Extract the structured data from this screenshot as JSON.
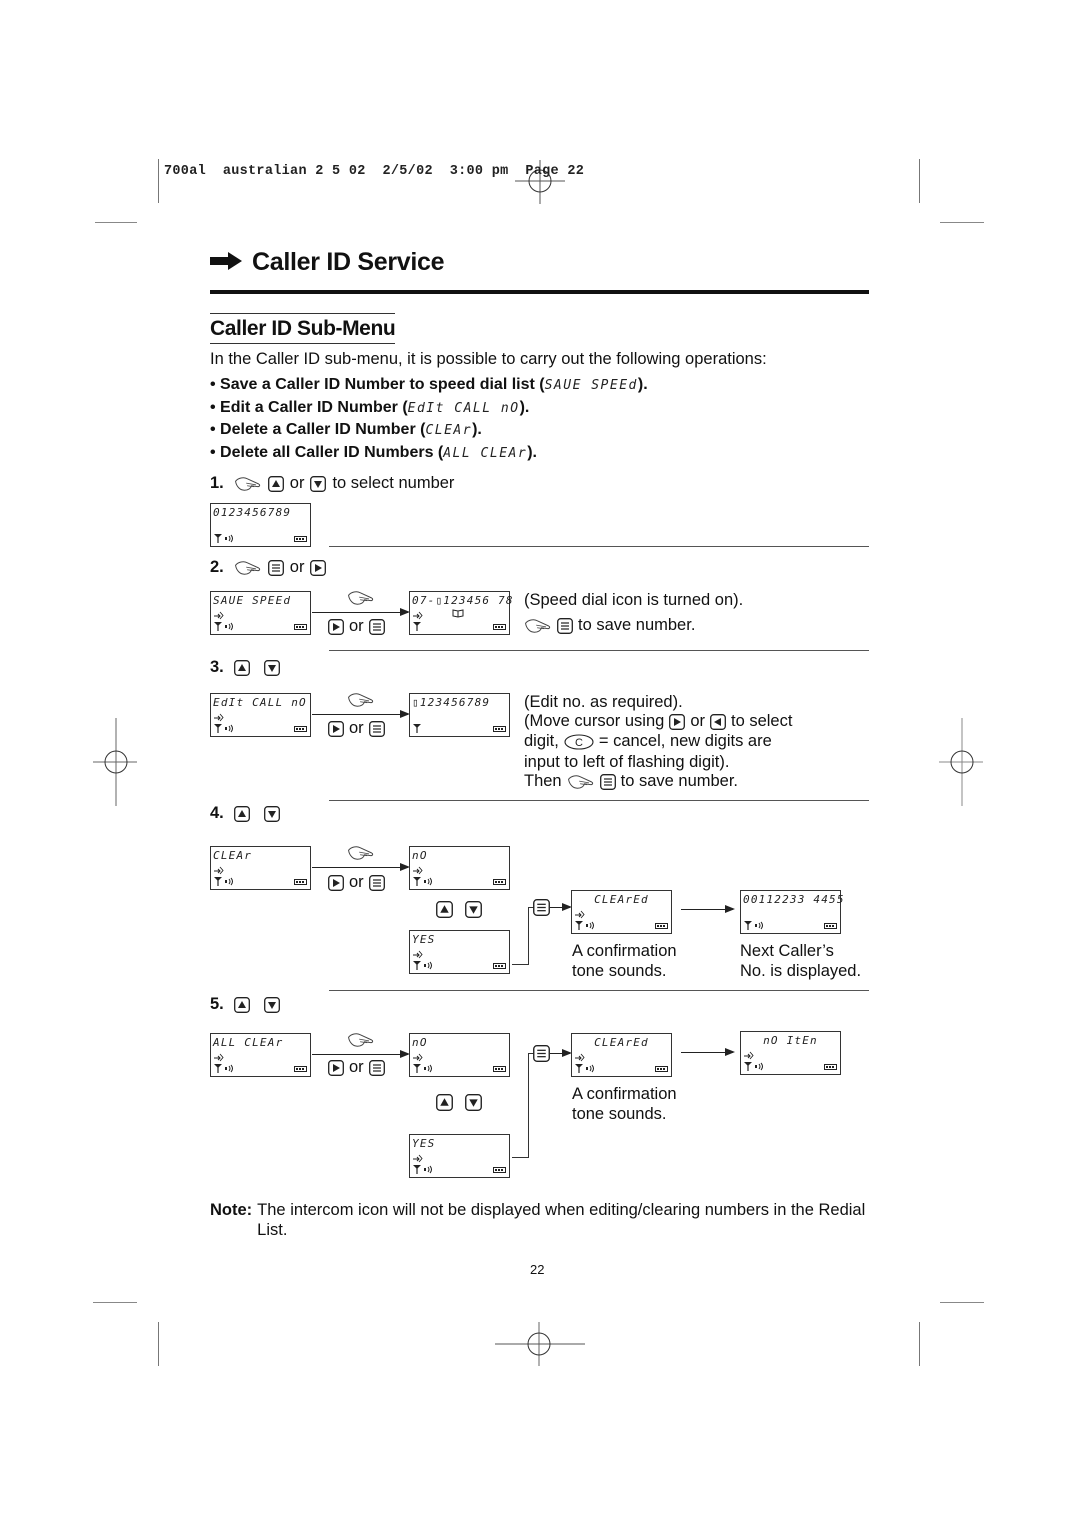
{
  "slug": {
    "job": "700al",
    "file": "australian 2 5 02",
    "date": "2/5/02",
    "time": "3:00 pm",
    "page_label": "Page 22"
  },
  "header": {
    "arrow_icon": "right-arrow-icon",
    "title": "Caller ID Service"
  },
  "section": {
    "title": "Caller ID Sub-Menu",
    "intro": "In the Caller ID sub-menu, it is possible to carry out the following operations:",
    "bullets": [
      {
        "text": "Save a Caller ID Number to speed dial list (",
        "lcd": "SAUE SPEEd",
        "end": ")."
      },
      {
        "text": "Edit a Caller ID Number (",
        "lcd": "EdIt CALL nO",
        "end": ")."
      },
      {
        "text": "Delete a Caller ID Number (",
        "lcd": "CLEAr",
        "end": ")."
      },
      {
        "text": "Delete all Caller ID Numbers (",
        "lcd": "ALL CLEAr",
        "end": ")."
      }
    ]
  },
  "icons": {
    "hand": "pointing-hand-icon",
    "up": "up-key-icon",
    "down": "down-key-icon",
    "right": "right-key-icon",
    "left": "left-key-icon",
    "menu": "menu-key-icon",
    "cancel": "C"
  },
  "steps": [
    {
      "num": "1.",
      "or": "or",
      "text": "to select number",
      "display": "0123456789"
    },
    {
      "num": "2.",
      "or": "or",
      "display_from": "SAUE SPEEd",
      "display_to": "07-▯123456 78",
      "or_label": "or",
      "note1": "(Speed dial icon is turned on).",
      "note2": "to save number."
    },
    {
      "num": "3.",
      "display_from": "EdIt CALL nO",
      "display_to": "▯123456789",
      "or_label": "or",
      "notes": [
        "(Edit no. as required).",
        "(Move cursor using",
        "or",
        "to select",
        "digit,",
        "= cancel, new digits are",
        "input to left of flashing digit).",
        "Then",
        "to save number."
      ]
    },
    {
      "num": "4.",
      "display_from": "CLEAr",
      "display_no": "nO",
      "display_yes": "YES",
      "display_cleared": "CLEArEd",
      "display_next": "00112233 4455",
      "or_label": "or",
      "confirm_1": "A confirmation",
      "confirm_2": "tone sounds.",
      "next_1": "Next Caller’s",
      "next_2": "No. is displayed."
    },
    {
      "num": "5.",
      "display_from": "ALL CLEAr",
      "display_no": "nO",
      "display_yes": "YES",
      "display_cleared": "CLEArEd",
      "display_noitem": "nO ItEn",
      "or_label": "or",
      "confirm_1": "A confirmation",
      "confirm_2": "tone sounds."
    }
  ],
  "note": {
    "label": "Note:",
    "text": "The intercom icon will not be displayed when editing/clearing numbers in the Redial List."
  },
  "page_number": "22"
}
